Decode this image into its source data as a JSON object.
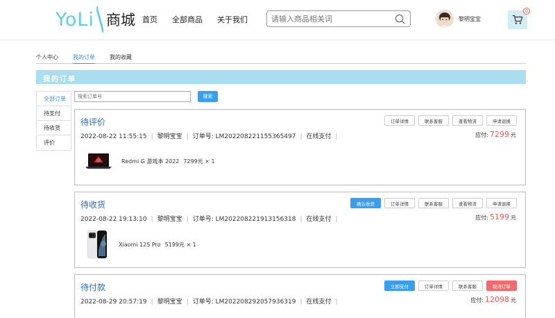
{
  "header": {
    "logo_text": "YoLi",
    "logo_cn": "商城",
    "nav": [
      "首页",
      "全部商品",
      "关于我们"
    ],
    "search_placeholder": "请输入商品相关词",
    "username": "黎明宝宝",
    "cart_count": "0"
  },
  "tabs": [
    {
      "label": "个人中心",
      "active": false
    },
    {
      "label": "我的订单",
      "active": true
    },
    {
      "label": "我的收藏",
      "active": false
    }
  ],
  "banner_title": "我的订单",
  "sidebar": [
    {
      "label": "全部订单",
      "active": true
    },
    {
      "label": "待支付",
      "active": false
    },
    {
      "label": "待收货",
      "active": false
    },
    {
      "label": "评价",
      "active": false
    }
  ],
  "order_search": {
    "placeholder": "搜索订单号",
    "button_label": "搜索"
  },
  "orders": [
    {
      "status": "待评价",
      "datetime": "2022-08-22 11:55:15",
      "user": "黎明宝宝",
      "order_no_label": "订单号:",
      "order_no": "LM202208221155365497",
      "pay_method": "在线支付",
      "payable_label": "应付:",
      "amount": "7299",
      "currency": "元",
      "actions": [
        "订单详情",
        "联系客服",
        "查看物流",
        "申请退换"
      ],
      "product": {
        "name": "Redmi G 游戏本 2022",
        "price_qty": "7299元 × 1",
        "icon": "laptop-image"
      }
    },
    {
      "status": "待收货",
      "datetime": "2022-08-22 19:13:10",
      "user": "黎明宝宝",
      "order_no_label": "订单号:",
      "order_no": "LM202208221913156318",
      "pay_method": "在线支付",
      "payable_label": "应付:",
      "amount": "5199",
      "currency": "元",
      "actions": [
        "确认收货",
        "订单详情",
        "联系客服",
        "查看物流",
        "申请退换"
      ],
      "product": {
        "name": "Xiaomi 12S Pro",
        "price_qty": "5199元 × 1",
        "icon": "phone-image"
      }
    },
    {
      "status": "待付款",
      "datetime": "2022-08-29 20:57:19",
      "user": "黎明宝宝",
      "order_no_label": "订单号:",
      "order_no": "LM202208292057936319",
      "pay_method": "在线支付",
      "payable_label": "应付:",
      "amount": "12098",
      "currency": "元",
      "actions": [
        "立即支付",
        "订单详情",
        "联系客服",
        "取消订单"
      ]
    }
  ],
  "colors": {
    "accent": "#3a9ef0",
    "brand": "#5ecfe0",
    "price": "#e85a4f",
    "banner": "#a9ddf0",
    "danger": "#f26b6b"
  }
}
